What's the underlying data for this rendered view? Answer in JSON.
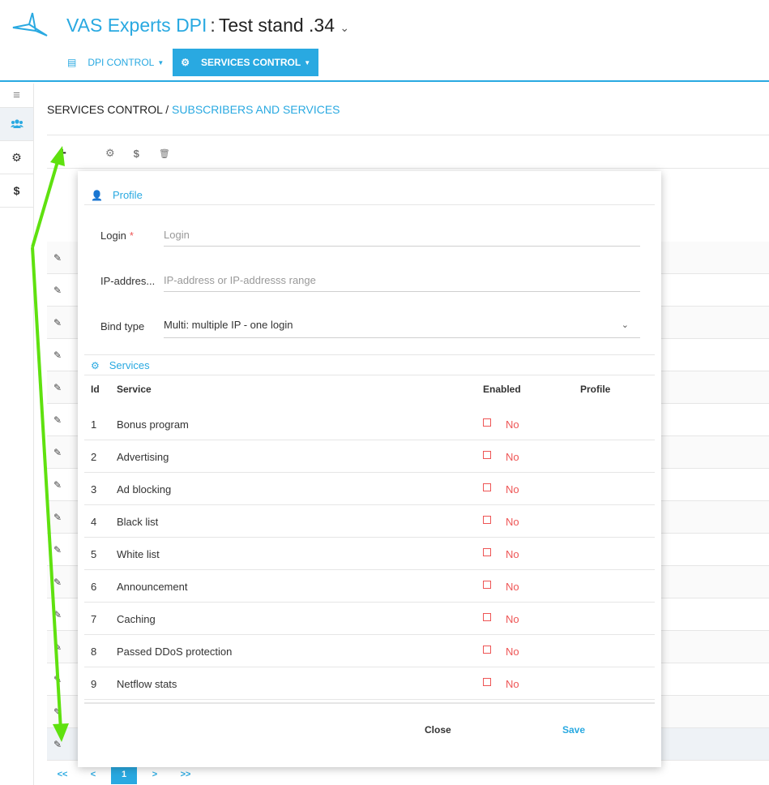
{
  "header": {
    "brand": "VAS Experts DPI",
    "separator": ":",
    "stand": "Test stand .34",
    "stand_caret": "⌄",
    "nav": [
      {
        "label": "DPI CONTROL",
        "icon": "server-icon"
      },
      {
        "label": "SERVICES CONTROL",
        "icon": "gears-icon"
      }
    ]
  },
  "sidebar": {
    "items": [
      {
        "icon": "menu-icon",
        "glyph": "≡"
      },
      {
        "icon": "users-icon",
        "glyph": "👥"
      },
      {
        "icon": "gears-icon",
        "glyph": "⚙"
      },
      {
        "icon": "dollar-icon",
        "glyph": "$"
      }
    ]
  },
  "breadcrumb": {
    "root": "SERVICES CONTROL /",
    "current": "SUBSCRIBERS AND SERVICES"
  },
  "toolbar": {
    "add": "+",
    "services": "⚙",
    "tariff": "$",
    "delete": "🗑"
  },
  "pager": {
    "first": "<<",
    "prev": "<",
    "current": "1",
    "next": ">",
    "last": ">>"
  },
  "modal": {
    "profile_title": "Profile",
    "login_label": "Login",
    "required_mark": "*",
    "login_placeholder": "Login",
    "ip_label": "IP-addres...",
    "ip_placeholder": "IP-address or IP-addresss range",
    "bind_label": "Bind type",
    "bind_value": "Multi: multiple IP - one login",
    "services_title": "Services",
    "columns": {
      "id": "Id",
      "service": "Service",
      "enabled": "Enabled",
      "profile": "Profile"
    },
    "services": [
      {
        "id": "1",
        "name": "Bonus program",
        "enabled": "No"
      },
      {
        "id": "2",
        "name": "Advertising",
        "enabled": "No"
      },
      {
        "id": "3",
        "name": "Ad blocking",
        "enabled": "No"
      },
      {
        "id": "4",
        "name": "Black list",
        "enabled": "No"
      },
      {
        "id": "5",
        "name": "White list",
        "enabled": "No"
      },
      {
        "id": "6",
        "name": "Announcement",
        "enabled": "No"
      },
      {
        "id": "7",
        "name": "Caching",
        "enabled": "No"
      },
      {
        "id": "8",
        "name": "Passed DDoS protection",
        "enabled": "No"
      },
      {
        "id": "9",
        "name": "Netflow stats",
        "enabled": "No"
      }
    ],
    "close_label": "Close",
    "save_label": "Save"
  },
  "colors": {
    "accent": "#29a9e1",
    "danger": "#e55555",
    "arrow": "#5fe10f"
  }
}
